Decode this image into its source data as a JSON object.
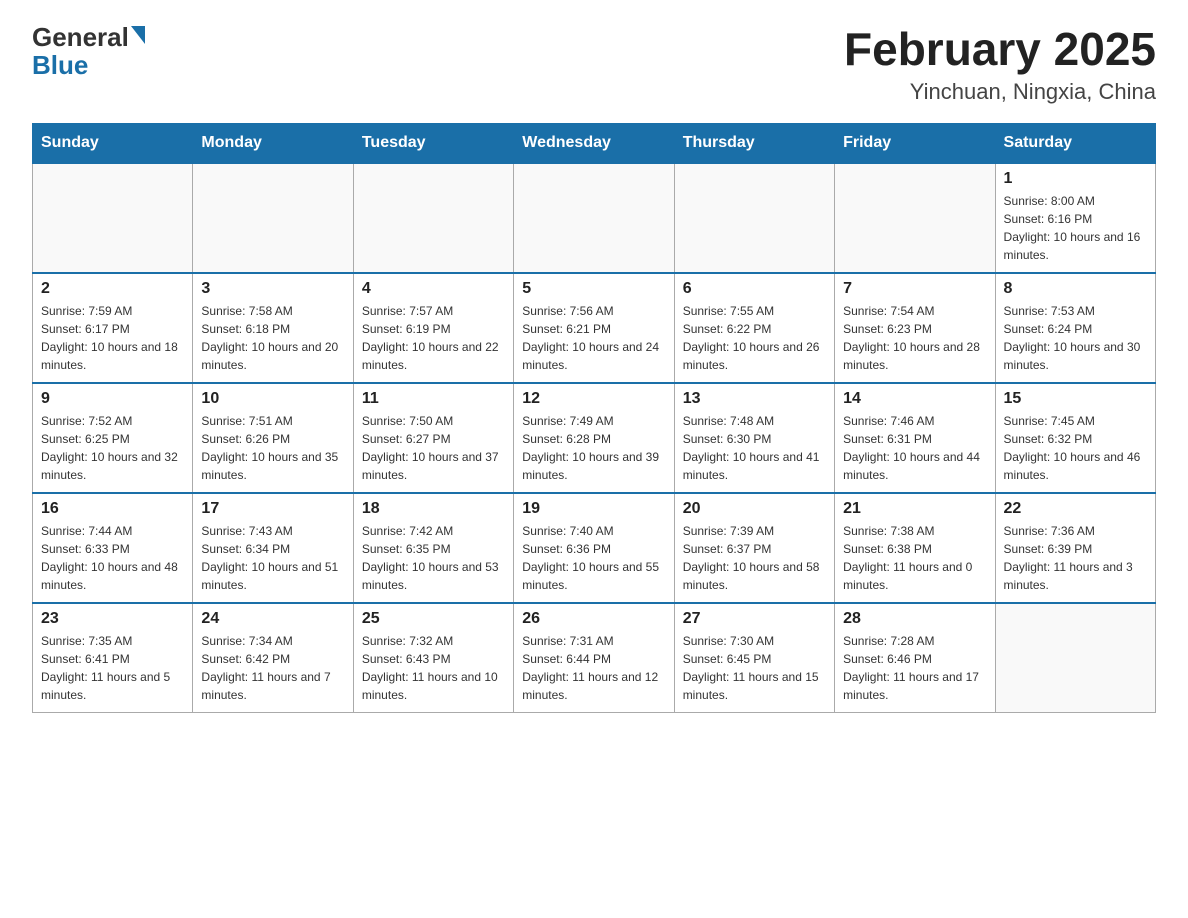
{
  "header": {
    "logo": {
      "general": "General",
      "blue": "Blue",
      "arrow_color": "#1a6fa8"
    },
    "title": "February 2025",
    "subtitle": "Yinchuan, Ningxia, China"
  },
  "calendar": {
    "days_of_week": [
      "Sunday",
      "Monday",
      "Tuesday",
      "Wednesday",
      "Thursday",
      "Friday",
      "Saturday"
    ],
    "weeks": [
      [
        {
          "day": "",
          "info": ""
        },
        {
          "day": "",
          "info": ""
        },
        {
          "day": "",
          "info": ""
        },
        {
          "day": "",
          "info": ""
        },
        {
          "day": "",
          "info": ""
        },
        {
          "day": "",
          "info": ""
        },
        {
          "day": "1",
          "info": "Sunrise: 8:00 AM\nSunset: 6:16 PM\nDaylight: 10 hours and 16 minutes."
        }
      ],
      [
        {
          "day": "2",
          "info": "Sunrise: 7:59 AM\nSunset: 6:17 PM\nDaylight: 10 hours and 18 minutes."
        },
        {
          "day": "3",
          "info": "Sunrise: 7:58 AM\nSunset: 6:18 PM\nDaylight: 10 hours and 20 minutes."
        },
        {
          "day": "4",
          "info": "Sunrise: 7:57 AM\nSunset: 6:19 PM\nDaylight: 10 hours and 22 minutes."
        },
        {
          "day": "5",
          "info": "Sunrise: 7:56 AM\nSunset: 6:21 PM\nDaylight: 10 hours and 24 minutes."
        },
        {
          "day": "6",
          "info": "Sunrise: 7:55 AM\nSunset: 6:22 PM\nDaylight: 10 hours and 26 minutes."
        },
        {
          "day": "7",
          "info": "Sunrise: 7:54 AM\nSunset: 6:23 PM\nDaylight: 10 hours and 28 minutes."
        },
        {
          "day": "8",
          "info": "Sunrise: 7:53 AM\nSunset: 6:24 PM\nDaylight: 10 hours and 30 minutes."
        }
      ],
      [
        {
          "day": "9",
          "info": "Sunrise: 7:52 AM\nSunset: 6:25 PM\nDaylight: 10 hours and 32 minutes."
        },
        {
          "day": "10",
          "info": "Sunrise: 7:51 AM\nSunset: 6:26 PM\nDaylight: 10 hours and 35 minutes."
        },
        {
          "day": "11",
          "info": "Sunrise: 7:50 AM\nSunset: 6:27 PM\nDaylight: 10 hours and 37 minutes."
        },
        {
          "day": "12",
          "info": "Sunrise: 7:49 AM\nSunset: 6:28 PM\nDaylight: 10 hours and 39 minutes."
        },
        {
          "day": "13",
          "info": "Sunrise: 7:48 AM\nSunset: 6:30 PM\nDaylight: 10 hours and 41 minutes."
        },
        {
          "day": "14",
          "info": "Sunrise: 7:46 AM\nSunset: 6:31 PM\nDaylight: 10 hours and 44 minutes."
        },
        {
          "day": "15",
          "info": "Sunrise: 7:45 AM\nSunset: 6:32 PM\nDaylight: 10 hours and 46 minutes."
        }
      ],
      [
        {
          "day": "16",
          "info": "Sunrise: 7:44 AM\nSunset: 6:33 PM\nDaylight: 10 hours and 48 minutes."
        },
        {
          "day": "17",
          "info": "Sunrise: 7:43 AM\nSunset: 6:34 PM\nDaylight: 10 hours and 51 minutes."
        },
        {
          "day": "18",
          "info": "Sunrise: 7:42 AM\nSunset: 6:35 PM\nDaylight: 10 hours and 53 minutes."
        },
        {
          "day": "19",
          "info": "Sunrise: 7:40 AM\nSunset: 6:36 PM\nDaylight: 10 hours and 55 minutes."
        },
        {
          "day": "20",
          "info": "Sunrise: 7:39 AM\nSunset: 6:37 PM\nDaylight: 10 hours and 58 minutes."
        },
        {
          "day": "21",
          "info": "Sunrise: 7:38 AM\nSunset: 6:38 PM\nDaylight: 11 hours and 0 minutes."
        },
        {
          "day": "22",
          "info": "Sunrise: 7:36 AM\nSunset: 6:39 PM\nDaylight: 11 hours and 3 minutes."
        }
      ],
      [
        {
          "day": "23",
          "info": "Sunrise: 7:35 AM\nSunset: 6:41 PM\nDaylight: 11 hours and 5 minutes."
        },
        {
          "day": "24",
          "info": "Sunrise: 7:34 AM\nSunset: 6:42 PM\nDaylight: 11 hours and 7 minutes."
        },
        {
          "day": "25",
          "info": "Sunrise: 7:32 AM\nSunset: 6:43 PM\nDaylight: 11 hours and 10 minutes."
        },
        {
          "day": "26",
          "info": "Sunrise: 7:31 AM\nSunset: 6:44 PM\nDaylight: 11 hours and 12 minutes."
        },
        {
          "day": "27",
          "info": "Sunrise: 7:30 AM\nSunset: 6:45 PM\nDaylight: 11 hours and 15 minutes."
        },
        {
          "day": "28",
          "info": "Sunrise: 7:28 AM\nSunset: 6:46 PM\nDaylight: 11 hours and 17 minutes."
        },
        {
          "day": "",
          "info": ""
        }
      ]
    ]
  }
}
